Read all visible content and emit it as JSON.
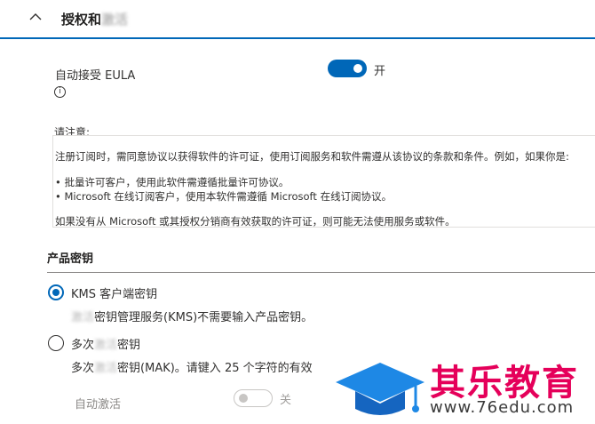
{
  "section": {
    "title": "授权和",
    "title_blurred": "激活",
    "icon": "chevron-up-icon"
  },
  "eula": {
    "label": "自动接受 EULA",
    "info_icon": "i",
    "toggle_state": "开",
    "toggle_on": true
  },
  "notice": {
    "title": "请注意:",
    "lines": [
      "注册订阅时，需同意协议以获得软件的许可证，使用订阅服务和软件需遵从该协议的条款和条件。例如，如果你是:",
      "• 批量许可客户，使用此软件需遵循批量许可协议。",
      "• Microsoft 在线订阅客户，使用本软件需遵循 Microsoft 在线订阅协议。",
      "如果没有从 Microsoft 或其授权分销商有效获取的许可证，则可能无法使用服务或软件。"
    ]
  },
  "product_key": {
    "title": "产品密钥",
    "options": [
      {
        "label": "KMS 客户端密钥",
        "selected": true,
        "desc_blurred": "激活",
        "desc": "密钥管理服务(KMS)不需要输入产品密钥。"
      },
      {
        "label_prefix": "多次",
        "label_blurred": "激活",
        "label_suffix": "密钥",
        "selected": false,
        "desc_prefix": "多次",
        "desc_blurred": "激活",
        "desc": "密钥(MAK)。请键入 25 个字符的有效"
      }
    ]
  },
  "auto_activate": {
    "label": "自动激活",
    "toggle_state": "关",
    "toggle_on": false
  },
  "watermark": {
    "brand": "其乐教育",
    "url": "www.76edu.com"
  },
  "colors": {
    "accent": "#0067b8",
    "brand": "#e5005a",
    "watermark_cap": "#1e88e5"
  }
}
